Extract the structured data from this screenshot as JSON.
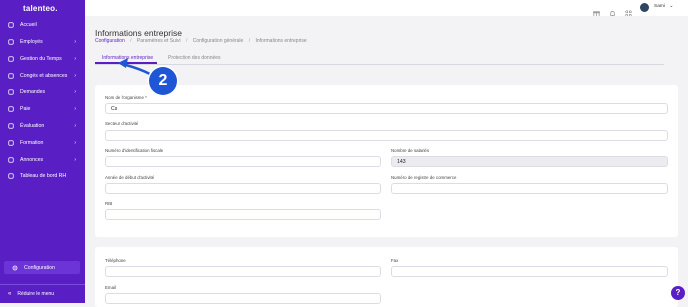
{
  "brand": "talenteo.",
  "sidebar": {
    "items": [
      {
        "label": "Accueil",
        "icon": "home-icon",
        "chevron": false
      },
      {
        "label": "Employés",
        "icon": "users-icon",
        "chevron": true
      },
      {
        "label": "Gestion du Temps",
        "icon": "clock-icon",
        "chevron": true
      },
      {
        "label": "Congés et absences",
        "icon": "calendar-icon",
        "chevron": true
      },
      {
        "label": "Demandes",
        "icon": "inbox-icon",
        "chevron": true
      },
      {
        "label": "Paie",
        "icon": "money-icon",
        "chevron": true
      },
      {
        "label": "Évaluation",
        "icon": "chart-icon",
        "chevron": true
      },
      {
        "label": "Formation",
        "icon": "graduation-icon",
        "chevron": true
      },
      {
        "label": "Annonces",
        "icon": "megaphone-icon",
        "chevron": true
      },
      {
        "label": "Tableau de bord RH",
        "icon": "dashboard-icon",
        "chevron": false
      }
    ],
    "config_label": "Configuration",
    "collapse_label": "Réduire le menu"
  },
  "topbar": {
    "user_name": "Sami"
  },
  "page": {
    "title": "Informations entreprise",
    "breadcrumb": [
      "Configuration",
      "Paramètres et Suivi",
      "Configuration générale",
      "Informations entreprise"
    ]
  },
  "tabs": [
    "Informations entreprise",
    "Protection des données"
  ],
  "form": {
    "org_name_label": "Nom de l'organisme *",
    "org_name_value": "Cs",
    "sector_label": "Secteur d'activité",
    "sector_value": "",
    "fiscal_id_label": "Numéro d'identification fiscale",
    "fiscal_id_value": "",
    "employees_label": "Nombre de salariés",
    "employees_value": "143",
    "start_year_label": "Année de début d'activité",
    "start_year_value": "",
    "trade_register_label": "Numéro de registre de commerce",
    "trade_register_value": "",
    "rib_label": "RIB",
    "rib_value": "",
    "phone_label": "Téléphone",
    "phone_value": "",
    "fax_label": "Fax",
    "fax_value": "",
    "email_label": "Email",
    "email_value": ""
  },
  "annotation": {
    "step": "2"
  },
  "help": "?",
  "colors": {
    "sidebar": "#5a1fc4",
    "accent": "#5a1fc4",
    "marker": "#1e56d6"
  }
}
